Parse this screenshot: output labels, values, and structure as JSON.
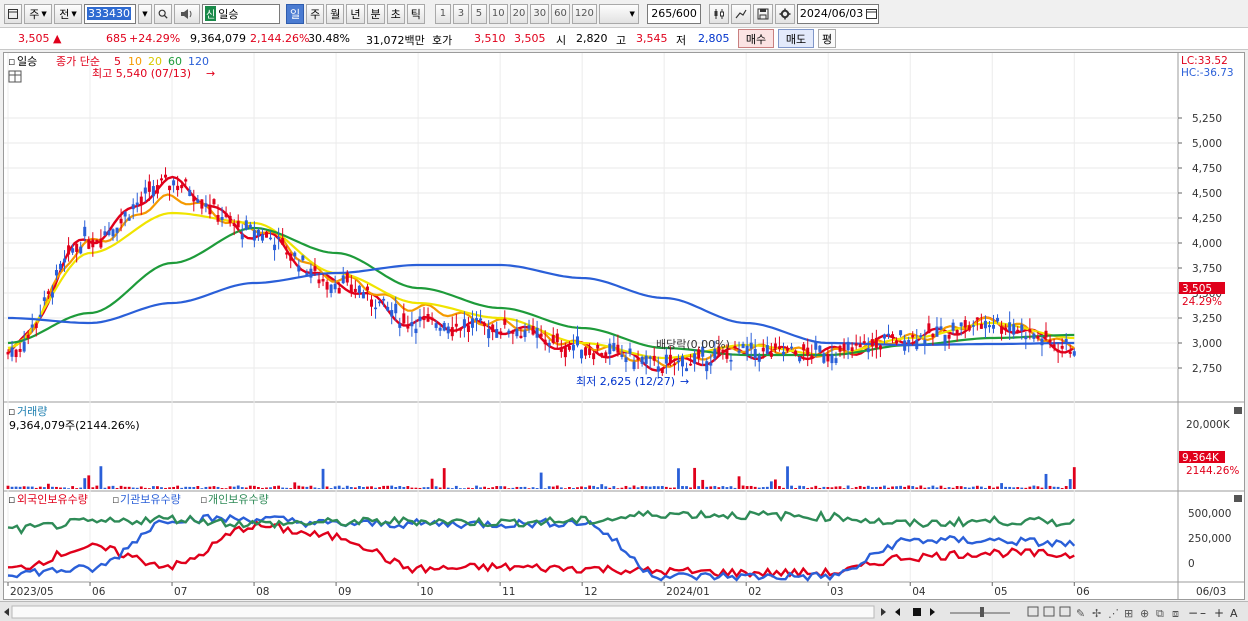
{
  "toolbar": {
    "market_label": "주",
    "prev_label": "전",
    "stock_code": "333430",
    "stock_badge": "신",
    "stock_name": "일승",
    "period_buttons": [
      "일",
      "주",
      "월",
      "년",
      "분",
      "초",
      "틱"
    ],
    "active_period": "일",
    "interval_buttons": [
      "1",
      "3",
      "5",
      "10",
      "20",
      "30",
      "60",
      "120"
    ],
    "data_count": "265",
    "data_total": "/600",
    "date": "2024/06/03"
  },
  "quote": {
    "price": "3,505",
    "change_arrow": "▲",
    "change": "685",
    "change_pct": "+24.29%",
    "volume": "9,364,079",
    "volume_pct": "2,144.26%",
    "turnover": "30.48%",
    "amount": "31,072백만",
    "hoga_label": "호가",
    "ask": "3,510",
    "bid": "3,505",
    "open_label": "시",
    "open": "2,820",
    "high_label": "고",
    "high": "3,545",
    "low_label": "저",
    "low": "2,805",
    "buy_label": "매수",
    "sell_label": "매도",
    "eval_label": "평"
  },
  "price_panel": {
    "name_tag": "일승",
    "legend_prefix": "종가 단순",
    "ma_periods": [
      "5",
      "10",
      "20",
      "60",
      "120"
    ],
    "ma_colors": [
      "#e0001b",
      "#f59a00",
      "#f0e400",
      "#1e9b3a",
      "#2a5fd8"
    ],
    "max_label": "최고 5,540 (07/13)",
    "min_label": "최저 2,625 (12/27)",
    "dividend_label": "배당락(0.00%)",
    "lc_label": "LC:33.52",
    "hc_label": "HC:-36.73",
    "current_price_tag": "3,505",
    "current_pct_tag": "24.29%",
    "y_ticks": [
      "5,250",
      "5,000",
      "4,750",
      "4,500",
      "4,250",
      "4,000",
      "3,750",
      "3,500",
      "3,250",
      "3,000",
      "2,750"
    ]
  },
  "volume_panel": {
    "title": "거래량",
    "value_label": "9,364,079주(2144.26%)",
    "y_tick": "20,000K",
    "current_tag": "9,364K",
    "current_pct_tag": "2144.26%"
  },
  "holdings_panel": {
    "legend": [
      "외국인보유수량",
      "기관보유수량",
      "개인보유수량"
    ],
    "colors": [
      "#e0001b",
      "#2a5fd8",
      "#2e8b57"
    ],
    "y_ticks": [
      "500,000",
      "250,000",
      "0"
    ]
  },
  "x_axis_labels": [
    "2023/05",
    "06",
    "07",
    "08",
    "09",
    "10",
    "11",
    "12",
    "2024/01",
    "02",
    "03",
    "04",
    "05",
    "06",
    "06/03"
  ],
  "chart_data": [
    {
      "type": "line",
      "title": "",
      "series_names": [
        "5",
        "10",
        "20",
        "60",
        "120"
      ],
      "x": [
        "2023/05",
        "2023/06",
        "2023/07",
        "2023/08",
        "2023/09",
        "2023/10",
        "2023/11",
        "2023/12",
        "2024/01",
        "2024/02",
        "2024/03",
        "2024/04",
        "2024/05",
        "2024/06"
      ],
      "series": [
        {
          "name": "5",
          "values": [
            2900,
            4050,
            4600,
            4100,
            3600,
            3200,
            3150,
            2950,
            2780,
            2900,
            2900,
            3050,
            3200,
            2950
          ]
        },
        {
          "name": "10",
          "values": [
            2920,
            4000,
            4450,
            4150,
            3650,
            3350,
            3200,
            2980,
            2800,
            2950,
            2900,
            3050,
            3220,
            2980
          ]
        },
        {
          "name": "20",
          "values": [
            2950,
            3900,
            4300,
            4200,
            3700,
            3400,
            3250,
            3000,
            2850,
            2980,
            2880,
            3050,
            3200,
            3050
          ]
        },
        {
          "name": "60",
          "values": [
            3000,
            3300,
            3800,
            4150,
            3900,
            3550,
            3350,
            3150,
            2950,
            2880,
            2880,
            2980,
            3050,
            3080
          ]
        },
        {
          "name": "120",
          "values": [
            3250,
            3200,
            3400,
            3600,
            3700,
            3780,
            3780,
            3650,
            3450,
            3200,
            3000,
            2980,
            2990,
            3000
          ]
        }
      ],
      "ylim": [
        2625,
        5540
      ],
      "max": 5540,
      "min": 2625,
      "last": 3505
    },
    {
      "type": "bar",
      "title": "거래량",
      "last_value_k": 9364,
      "ylim_k": [
        0,
        24000
      ]
    }
  ]
}
